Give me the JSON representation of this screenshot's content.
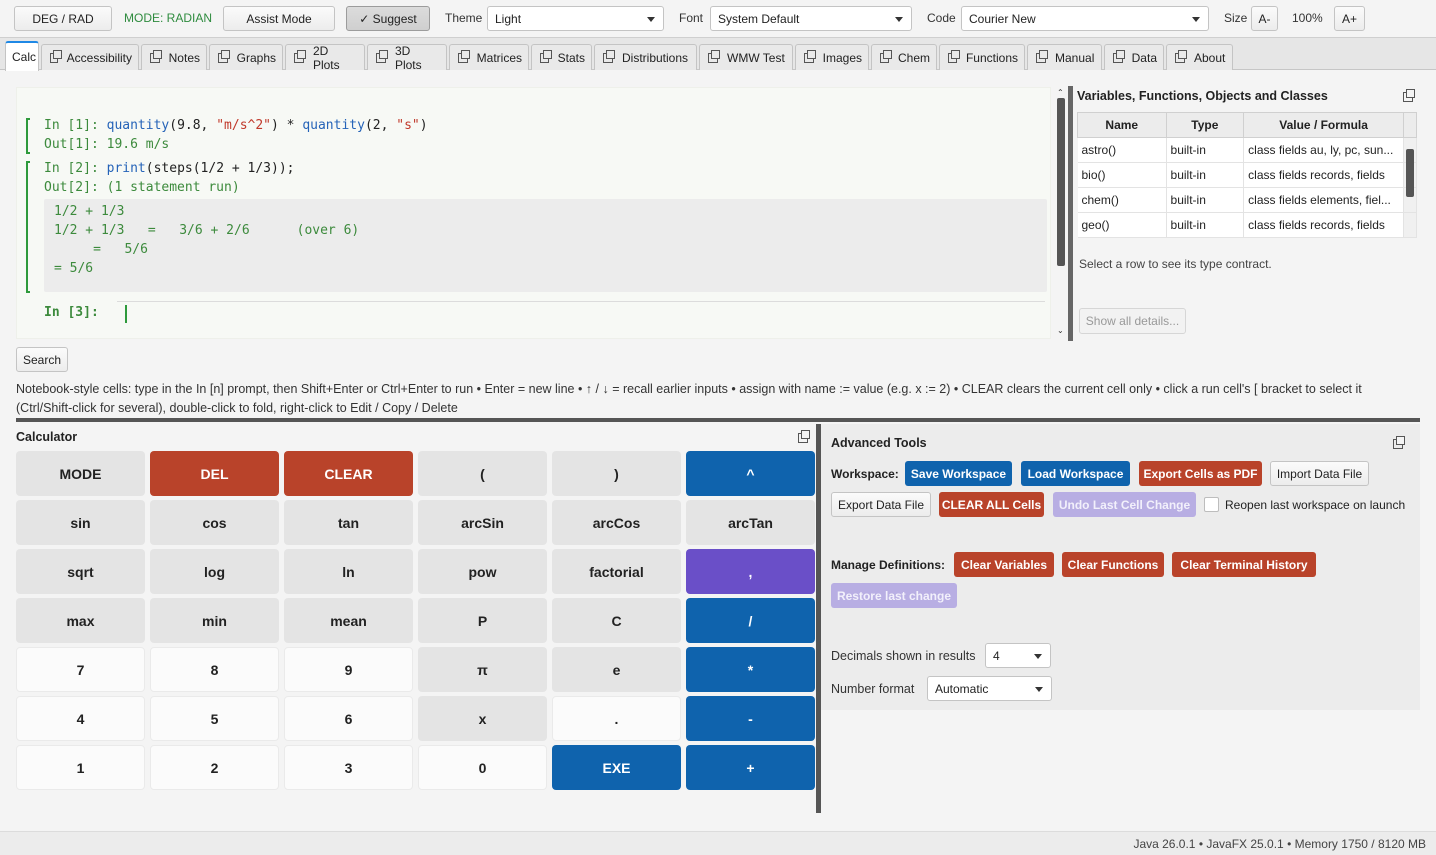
{
  "toolbar": {
    "deg_rad": "DEG / RAD",
    "mode": "MODE: RADIAN",
    "assist": "Assist Mode",
    "suggest": "✓ Suggest",
    "theme_label": "Theme",
    "theme_value": "Light",
    "font_label": "Font",
    "font_value": "System Default",
    "code_label": "Code",
    "code_value": "Courier New",
    "size_label": "Size",
    "size_minus": "A-",
    "size_value": "100%",
    "size_plus": "A+"
  },
  "tabs": [
    "Calc",
    "Accessibility",
    "Notes",
    "Graphs",
    "2D Plots",
    "3D Plots",
    "Matrices",
    "Stats",
    "Distributions",
    "WMW Test",
    "Images",
    "Chem",
    "Functions",
    "Manual",
    "Data",
    "About"
  ],
  "notebook": {
    "cell1_prompt": "In [1]:",
    "cell1_fn1": "quantity",
    "cell1_a": "(9.8, ",
    "cell1_s1": "\"m/s^2\"",
    "cell1_b": ") * ",
    "cell1_fn2": "quantity",
    "cell1_c": "(2, ",
    "cell1_s2": "\"s\"",
    "cell1_d": ")",
    "cell1_out": "Out[1]: 19.6 m/s",
    "cell2_prompt": "In [2]:",
    "cell2_fn": "print",
    "cell2_rest": "(steps(1/2 + 1/3));",
    "cell2_out": "Out[2]: (1 statement run)",
    "steps": [
      "1/2 + 1/3",
      "1/2 + 1/3   =   3/6 + 2/6      (over 6)",
      "     =   5/6",
      "= 5/6"
    ],
    "cell3_prompt": "In [3]:"
  },
  "vars": {
    "title": "Variables, Functions, Objects and Classes",
    "headers": [
      "Name",
      "Type",
      "Value / Formula"
    ],
    "rows": [
      [
        "astro()",
        "built-in",
        "class fields au, ly, pc, sun..."
      ],
      [
        "bio()",
        "built-in",
        "class fields records, fields"
      ],
      [
        "chem()",
        "built-in",
        "class fields elements, fiel..."
      ],
      [
        "geo()",
        "built-in",
        "class fields records, fields"
      ]
    ],
    "hint": "Select a row to see its type contract.",
    "show_all": "Show all details..."
  },
  "search_label": "Search",
  "help_text": "Notebook-style cells: type in the In [n] prompt, then Shift+Enter or Ctrl+Enter to run  •  Enter = new line  •  ↑ / ↓ = recall earlier inputs  •  assign with  name := value  (e.g. x := 2)  •  CLEAR clears the current cell only  •  click a run cell's [ bracket to select it (Ctrl/Shift-click for several), double-click to fold, right-click to Edit / Copy / Delete",
  "calculator": {
    "title": "Calculator",
    "keys": [
      [
        "MODE",
        "DEL",
        "CLEAR",
        "(",
        ")",
        "^"
      ],
      [
        "sin",
        "cos",
        "tan",
        "arcSin",
        "arcCos",
        "arcTan"
      ],
      [
        "sqrt",
        "log",
        "ln",
        "pow",
        "factorial",
        ","
      ],
      [
        "max",
        "min",
        "mean",
        "P",
        "C",
        "/"
      ],
      [
        "7",
        "8",
        "9",
        "π",
        "e",
        "*"
      ],
      [
        "4",
        "5",
        "6",
        "x",
        ".",
        "-"
      ],
      [
        "1",
        "2",
        "3",
        "0",
        "EXE",
        "+"
      ]
    ]
  },
  "advanced": {
    "title": "Advanced Tools",
    "workspace_label": "Workspace:",
    "save": "Save Workspace",
    "load": "Load Workspace",
    "export_pdf": "Export Cells as PDF",
    "import_data": "Import Data File",
    "export_data": "Export Data File",
    "clear_all": "CLEAR ALL Cells",
    "undo": "Undo Last Cell Change",
    "reopen": "Reopen last workspace on launch",
    "manage_label": "Manage Definitions:",
    "clear_vars": "Clear Variables",
    "clear_funcs": "Clear Functions",
    "clear_term": "Clear Terminal History",
    "restore": "Restore last change",
    "decimals_label": "Decimals shown in results",
    "decimals_value": "4",
    "format_label": "Number format",
    "format_value": "Automatic"
  },
  "status": "Java 26.0.1  •  JavaFX 25.0.1  •  Memory 1750 / 8120 MB",
  "colors": {
    "accent_blue": "#0f63ad",
    "danger_red": "#b9432a",
    "purple": "#6a4fc8",
    "prompt_green": "#3c8a3c"
  }
}
